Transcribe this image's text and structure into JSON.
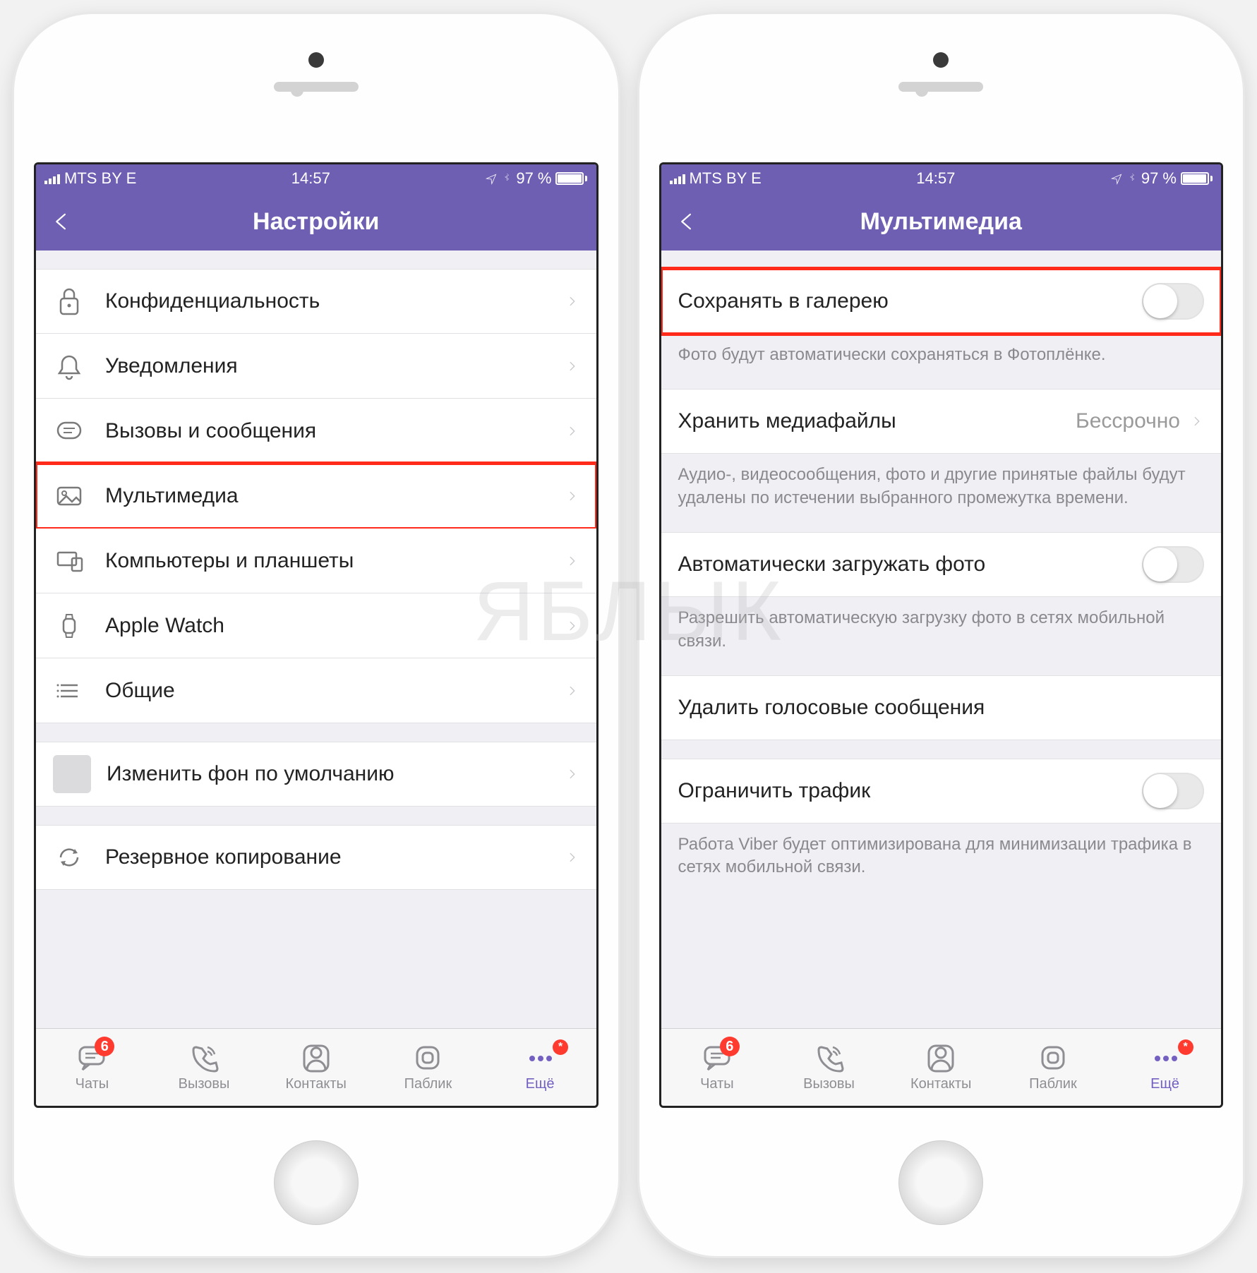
{
  "status": {
    "carrier": "MTS BY  E",
    "time": "14:57",
    "battery_text": "97 %"
  },
  "left": {
    "title": "Настройки",
    "items": [
      {
        "label": "Конфиденциальность",
        "icon": "lock"
      },
      {
        "label": "Уведомления",
        "icon": "bell"
      },
      {
        "label": "Вызовы и сообщения",
        "icon": "message"
      },
      {
        "label": "Мультимедиа",
        "icon": "image",
        "highlight": true
      },
      {
        "label": "Компьютеры и планшеты",
        "icon": "devices"
      },
      {
        "label": "Apple Watch",
        "icon": "watch"
      },
      {
        "label": "Общие",
        "icon": "list"
      }
    ],
    "extra1": {
      "label": "Изменить фон по умолчанию"
    },
    "extra2": {
      "label": "Резервное копирование",
      "icon": "refresh"
    }
  },
  "right": {
    "title": "Мультимедиа",
    "save_gallery": {
      "label": "Сохранять в галерею",
      "footer": "Фото будут автоматически сохраняться в Фотоплёнке."
    },
    "store_media": {
      "label": "Хранить медиафайлы",
      "value": "Бессрочно",
      "footer": "Аудио-, видеосообщения, фото и другие принятые файлы будут удалены по истечении выбранного промежутка времени."
    },
    "autoload": {
      "label": "Автоматически загружать фото",
      "footer": "Разрешить автоматическую загрузку фото в сетях мобильной связи."
    },
    "delete_voice": {
      "label": "Удалить голосовые сообщения"
    },
    "limit_traffic": {
      "label": "Ограничить трафик",
      "footer": "Работа Viber будет оптимизирована для минимизации трафика в сетях мобильной связи."
    }
  },
  "tabs": {
    "chats": {
      "label": "Чаты",
      "badge": "6"
    },
    "calls": {
      "label": "Вызовы"
    },
    "contacts": {
      "label": "Контакты"
    },
    "public": {
      "label": "Паблик"
    },
    "more": {
      "label": "Ещё",
      "badge": "*"
    }
  },
  "watermark": "ЯБЛЫК"
}
